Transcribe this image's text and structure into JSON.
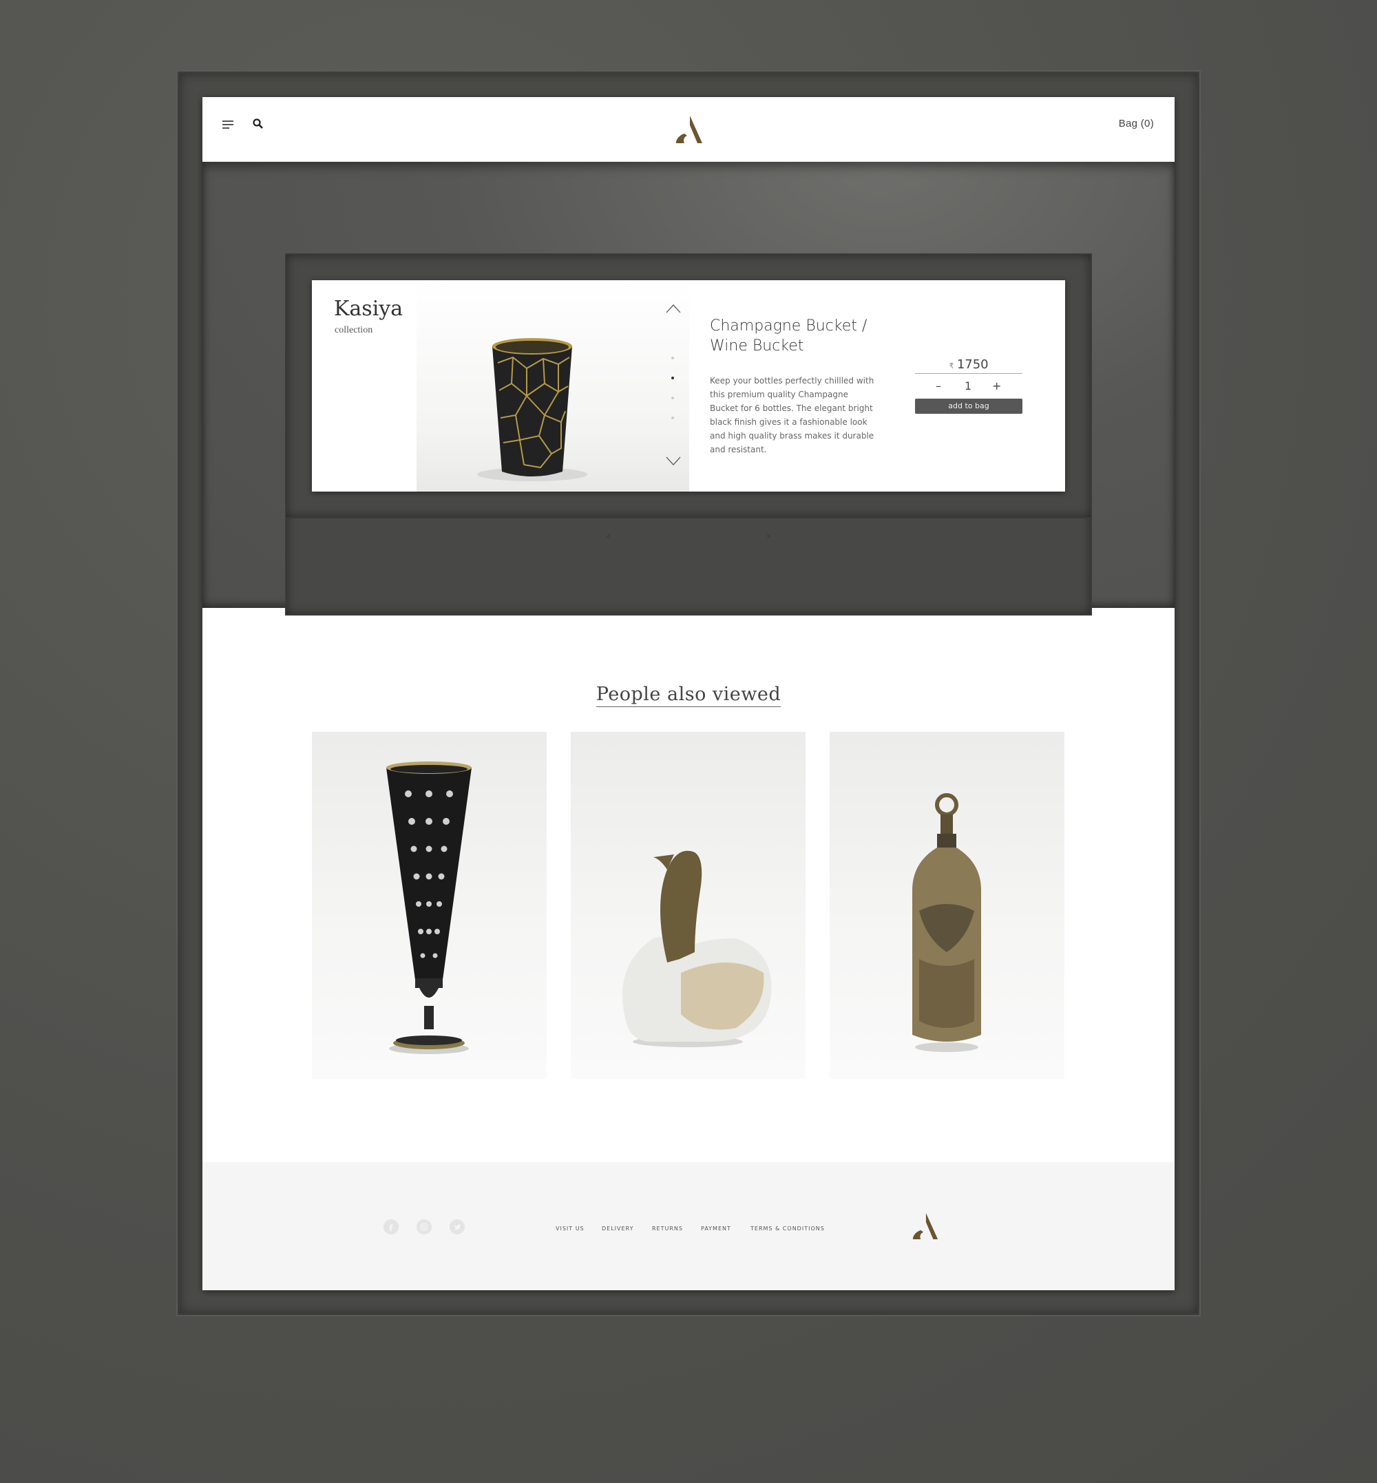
{
  "header": {
    "bag_label": "Bag (0)",
    "menu_icon": "menu-icon",
    "search_icon": "search-icon",
    "logo": "A"
  },
  "hero": {
    "collection_name": "Kasiya",
    "collection_label": "collection",
    "product_title": "Champagne Bucket / Wine Bucket",
    "product_description": "Keep your bottles perfectly chillled with this premium quality Champagne Bucket for 6 bottles. The elegant bright black finish gives it a fashionable look and high quality brass makes it durable and resistant.",
    "currency": "₹",
    "price": "1750",
    "quantity": "1",
    "qty_minus": "–",
    "qty_plus": "+",
    "add_to_bag": "add to bag",
    "image_slides_total": 4,
    "image_slide_active": 2
  },
  "also_viewed": {
    "title": "People also viewed",
    "items": [
      {
        "name": "tall black brass vase"
      },
      {
        "name": "swan figurine"
      },
      {
        "name": "engraved brass bottle"
      }
    ]
  },
  "footer": {
    "social": [
      "facebook-icon",
      "instagram-icon",
      "twitter-icon"
    ],
    "links": [
      "VISIT US",
      "DELIVERY",
      "RETURNS",
      "PAYMENT",
      "TERMS & CONDITIONS"
    ]
  },
  "colors": {
    "accent": "#6b5530",
    "background": "#535350",
    "button": "#575757"
  }
}
